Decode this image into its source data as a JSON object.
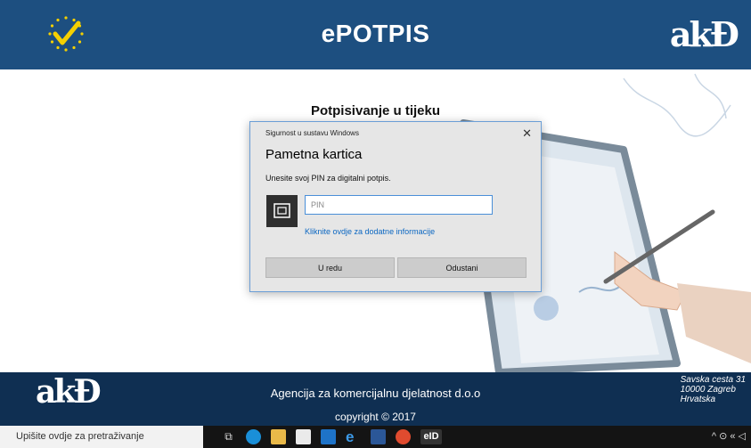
{
  "header": {
    "title": "ePOTPIS",
    "logo_text": "akƉ"
  },
  "main": {
    "status_title": "Potpisivanje u tijeku"
  },
  "dialog": {
    "caption": "Sigurnost u sustavu Windows",
    "title": "Pametna kartica",
    "instruction": "Unesite svoj PIN za digitalni potpis.",
    "pin_placeholder": "PIN",
    "more_info_link": "Kliknite ovdje za dodatne informacije",
    "ok_button": "U redu",
    "cancel_button": "Odustani",
    "close_glyph": "✕"
  },
  "footer": {
    "logo_text": "akƉ",
    "company": "Agencija za komercijalnu djelatnost d.o.o",
    "address": [
      "Savska cesta 31",
      "10000 Zagreb",
      "Hrvatska"
    ],
    "copyright": "copyright © 2017"
  },
  "taskbar": {
    "search_placeholder": "Upišite ovdje za pretraživanje",
    "eid_label": "eID",
    "tray_text": "^ ⊙ « ◁"
  },
  "colors": {
    "header": "#1d4f80",
    "footer": "#0f2f52",
    "link": "#0b67c2"
  }
}
